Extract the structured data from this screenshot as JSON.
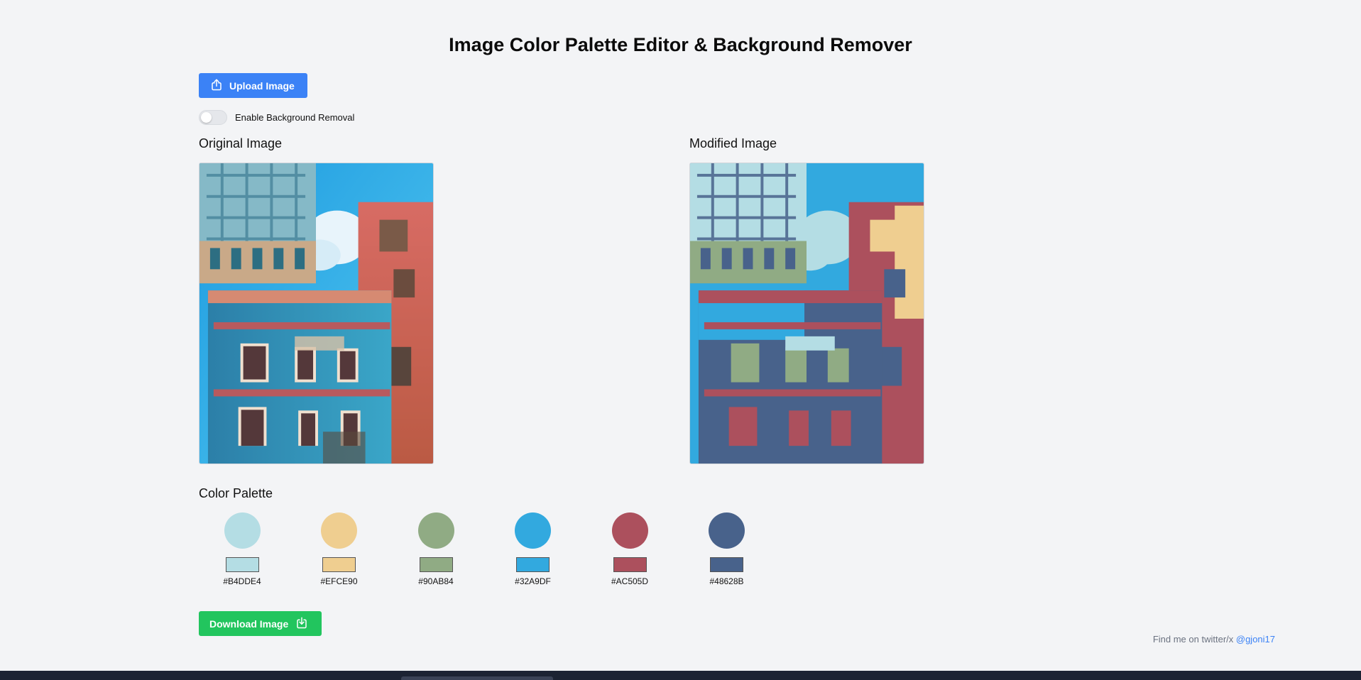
{
  "page": {
    "title": "Image Color Palette Editor & Background Remover"
  },
  "upload": {
    "label": "Upload Image"
  },
  "background_removal": {
    "label": "Enable Background Removal",
    "enabled": false
  },
  "original": {
    "heading": "Original Image"
  },
  "modified": {
    "heading": "Modified Image"
  },
  "palette": {
    "heading": "Color Palette",
    "colors": [
      {
        "hex": "#B4DDE4"
      },
      {
        "hex": "#EFCE90"
      },
      {
        "hex": "#90AB84"
      },
      {
        "hex": "#32A9DF"
      },
      {
        "hex": "#AC505D"
      },
      {
        "hex": "#48628B"
      }
    ]
  },
  "download": {
    "label": "Download Image"
  },
  "footer": {
    "text": "Find me on twitter/x ",
    "handle": "@gjoni17"
  },
  "colors": {
    "accent_blue": "#3b82f6",
    "accent_green": "#22c55e",
    "background": "#f3f4f6"
  }
}
